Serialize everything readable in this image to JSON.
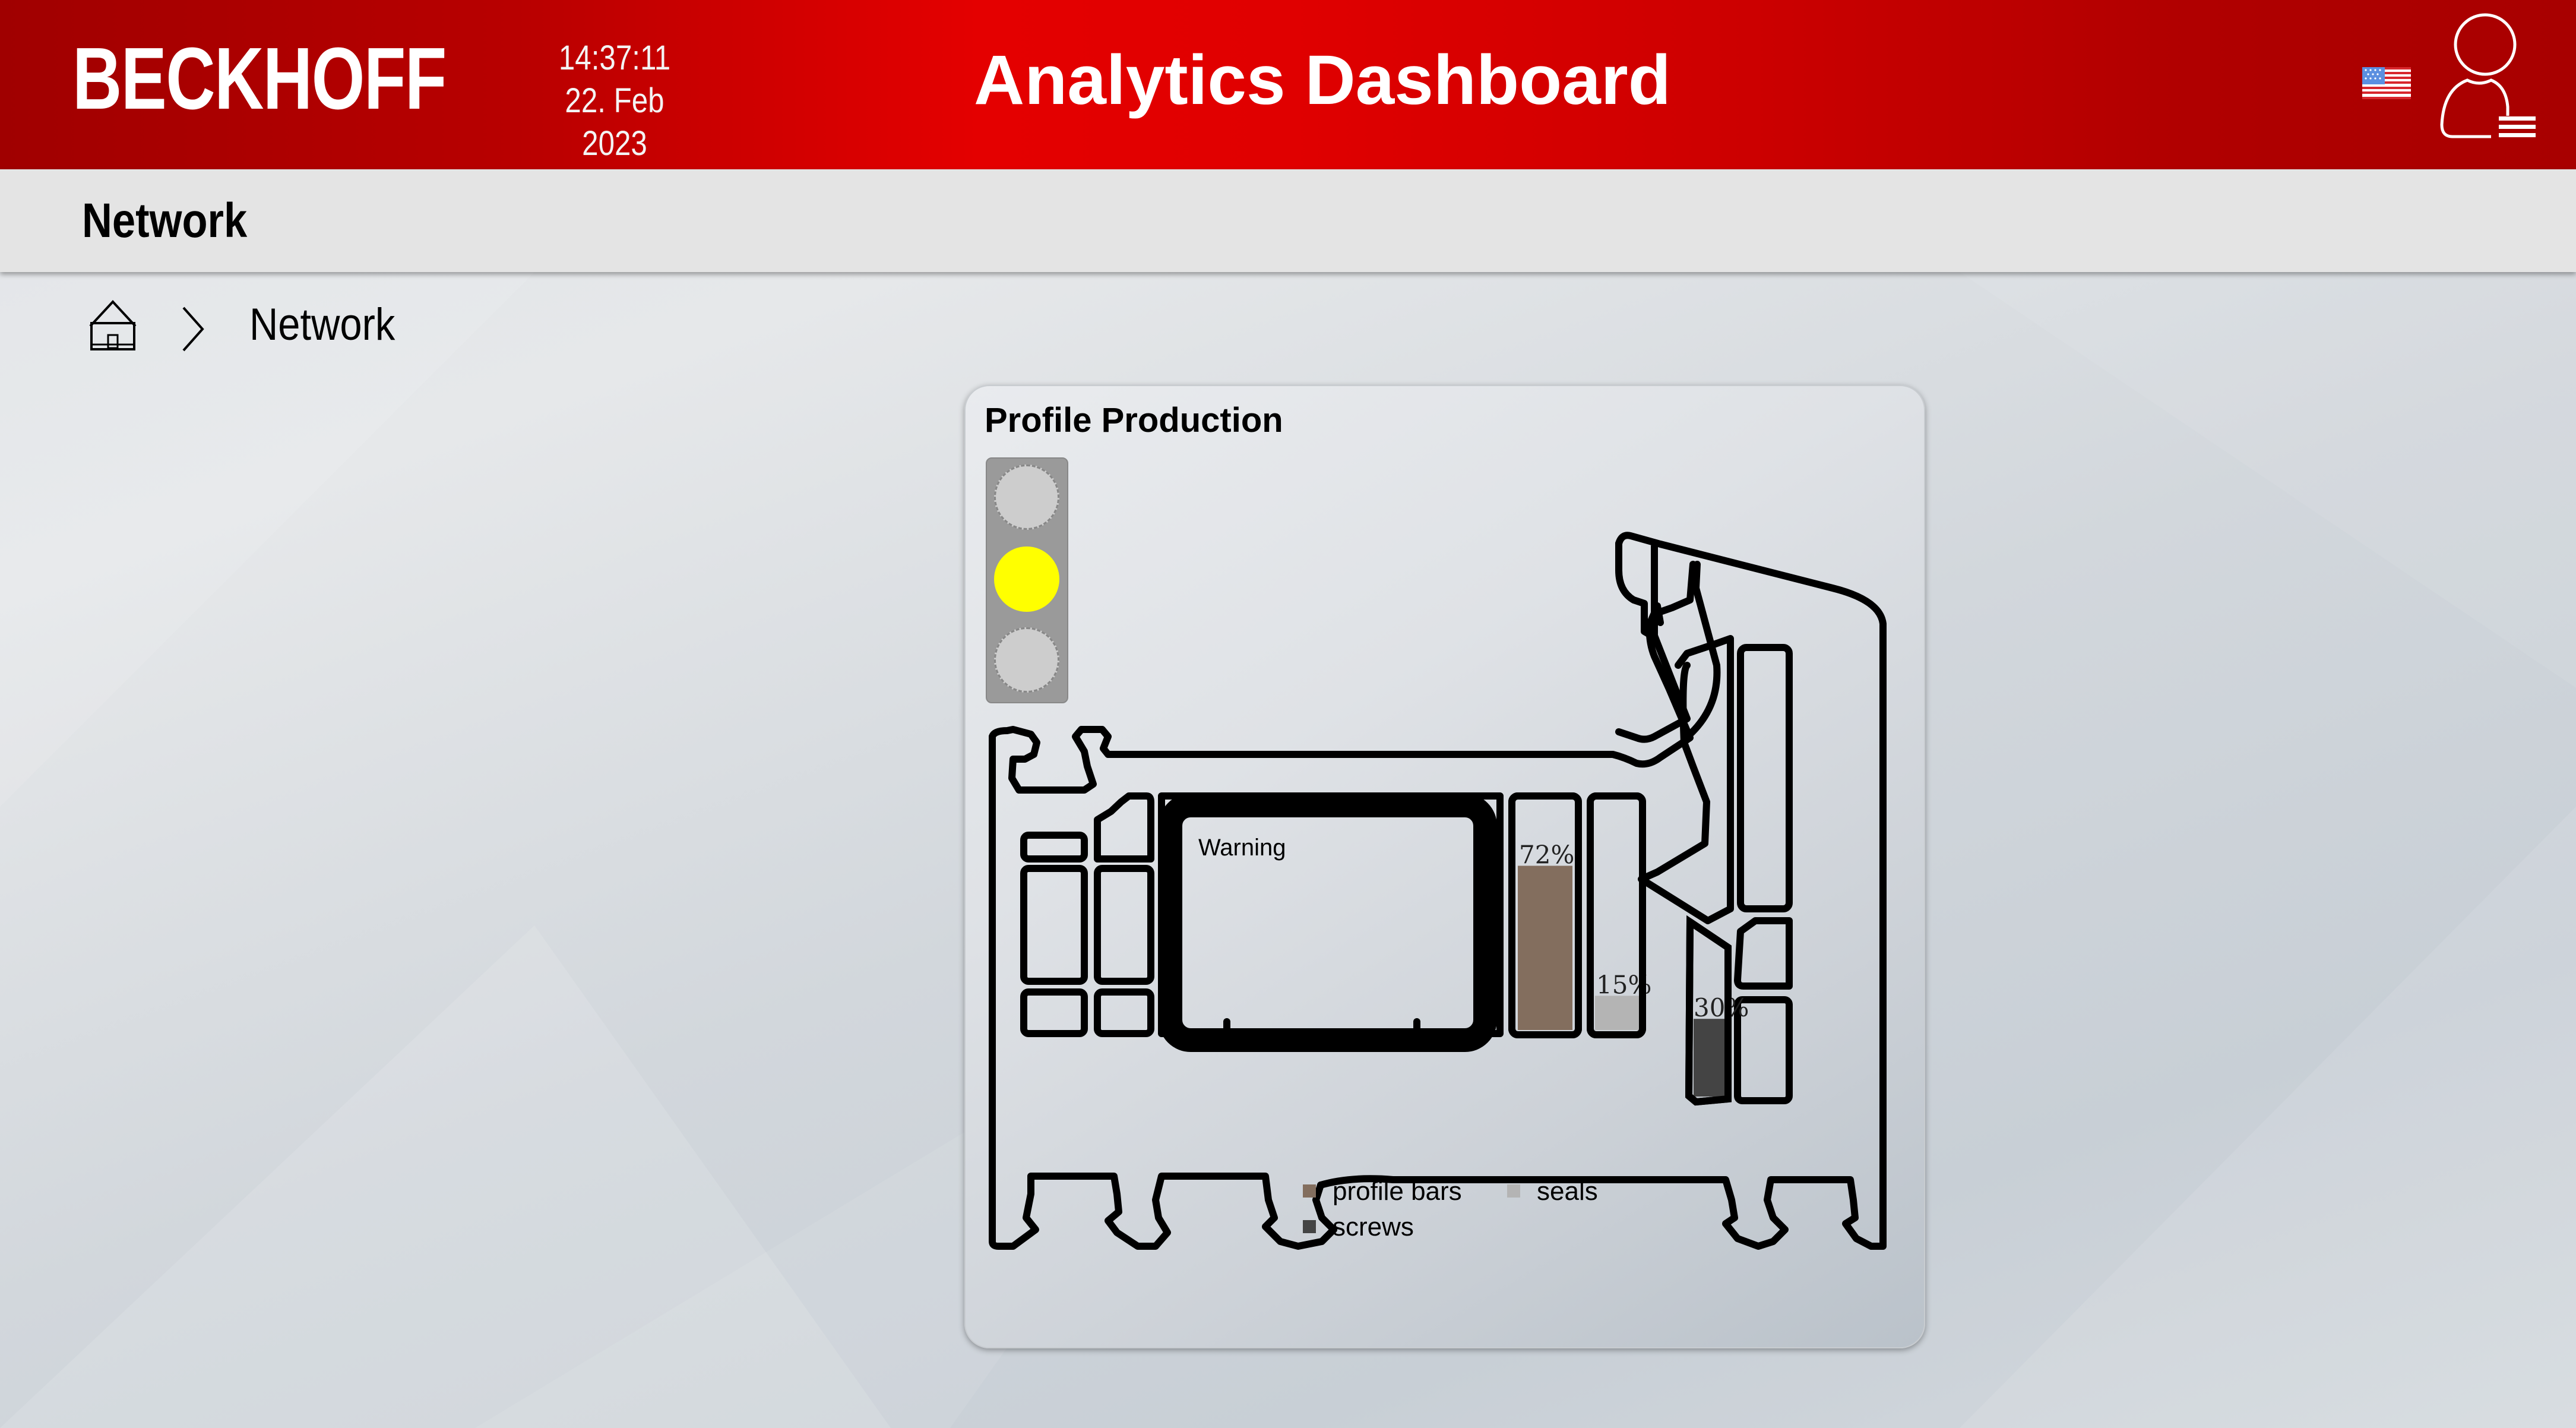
{
  "header": {
    "logo": "BECKHOFF",
    "time": "14:37:11",
    "date": "22. Feb 2023",
    "title": "Analytics Dashboard",
    "language_flag": "us-flag-icon",
    "user_icon": "user-menu-icon"
  },
  "navbar": {
    "title": "Network"
  },
  "breadcrumb": {
    "home_icon": "home-icon",
    "separator_icon": "chevron-right-icon",
    "current": "Network"
  },
  "card": {
    "title": "Profile Production",
    "traffic_light": {
      "states": [
        "off",
        "on",
        "off"
      ],
      "active": "yellow",
      "colors": {
        "on": "#ffff00",
        "off": "#cdcdcd",
        "housing": "#9a9a9a"
      }
    },
    "warning_label": "Warning",
    "levels": [
      {
        "name": "profile bars",
        "value": 72,
        "label": "72%",
        "color": "#836e5e"
      },
      {
        "name": "seals",
        "value": 15,
        "label": "15%",
        "color": "#b4b4b4"
      },
      {
        "name": "screws",
        "value": 30,
        "label": "30%",
        "color": "#444444"
      }
    ],
    "legend": [
      {
        "label": "profile bars",
        "color": "#836e5e"
      },
      {
        "label": "seals",
        "color": "#b4b4b4"
      },
      {
        "label": "screws",
        "color": "#444444"
      }
    ]
  },
  "colors": {
    "brand_red": "#e40000",
    "brand_dark_red": "#a00000",
    "navbar_bg": "#e4e4e4"
  }
}
